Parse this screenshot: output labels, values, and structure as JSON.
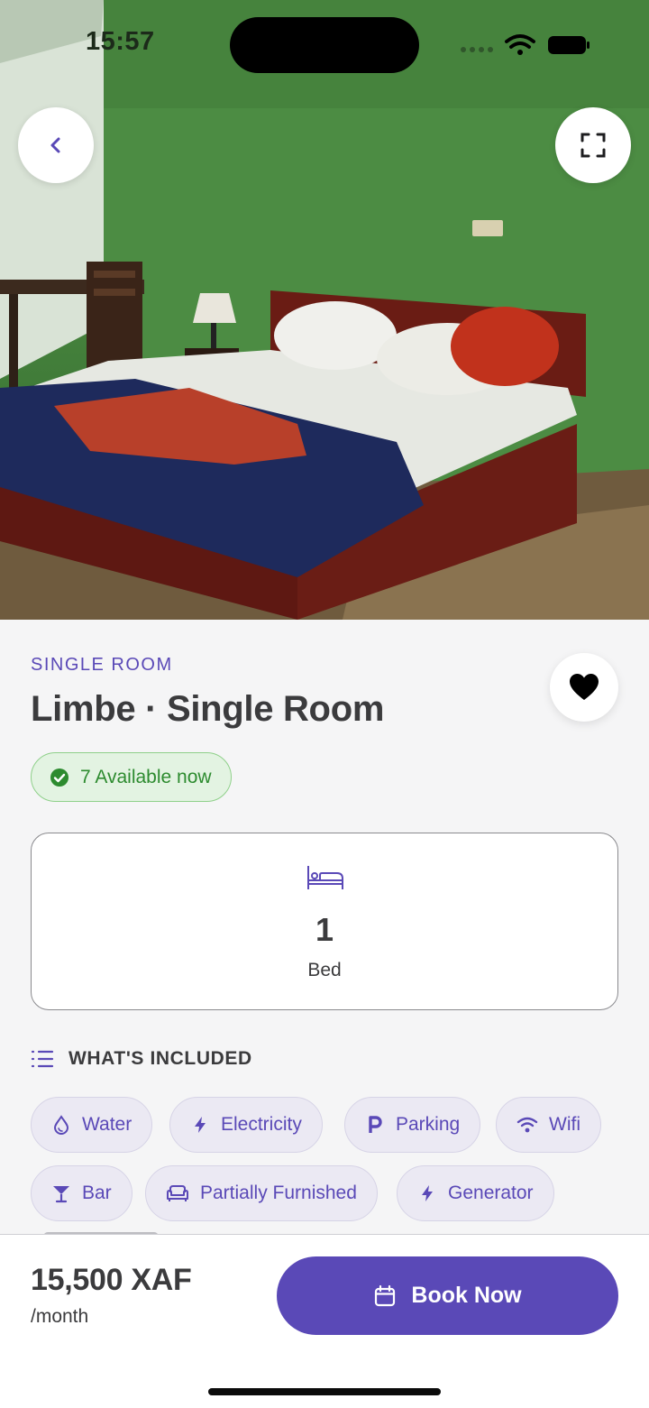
{
  "status_bar": {
    "time": "15:57"
  },
  "room": {
    "type_label": "SINGLE ROOM",
    "title": "Limbe · Single Room",
    "availability": "7 Available now",
    "bed_count": "1",
    "bed_label": "Bed"
  },
  "included": {
    "title": "WHAT'S INCLUDED",
    "amenities": [
      {
        "label": "Water",
        "icon": "water-drop-icon"
      },
      {
        "label": "Electricity",
        "icon": "lightning-icon"
      },
      {
        "label": "Parking",
        "icon": "parking-icon"
      },
      {
        "label": "Wifi",
        "icon": "wifi-icon"
      },
      {
        "label": "Bar",
        "icon": "cocktail-icon"
      },
      {
        "label": "Partially Furnished",
        "icon": "sofa-icon"
      },
      {
        "label": "Generator",
        "icon": "lightning-icon"
      }
    ]
  },
  "booking": {
    "price": "15,500 XAF",
    "period": "/month",
    "book_label": "Book Now"
  },
  "colors": {
    "accent": "#5a49b7",
    "available_green": "#2d8b2f",
    "available_bg": "#e3f3e2",
    "chip_bg": "#ebe9f3"
  }
}
